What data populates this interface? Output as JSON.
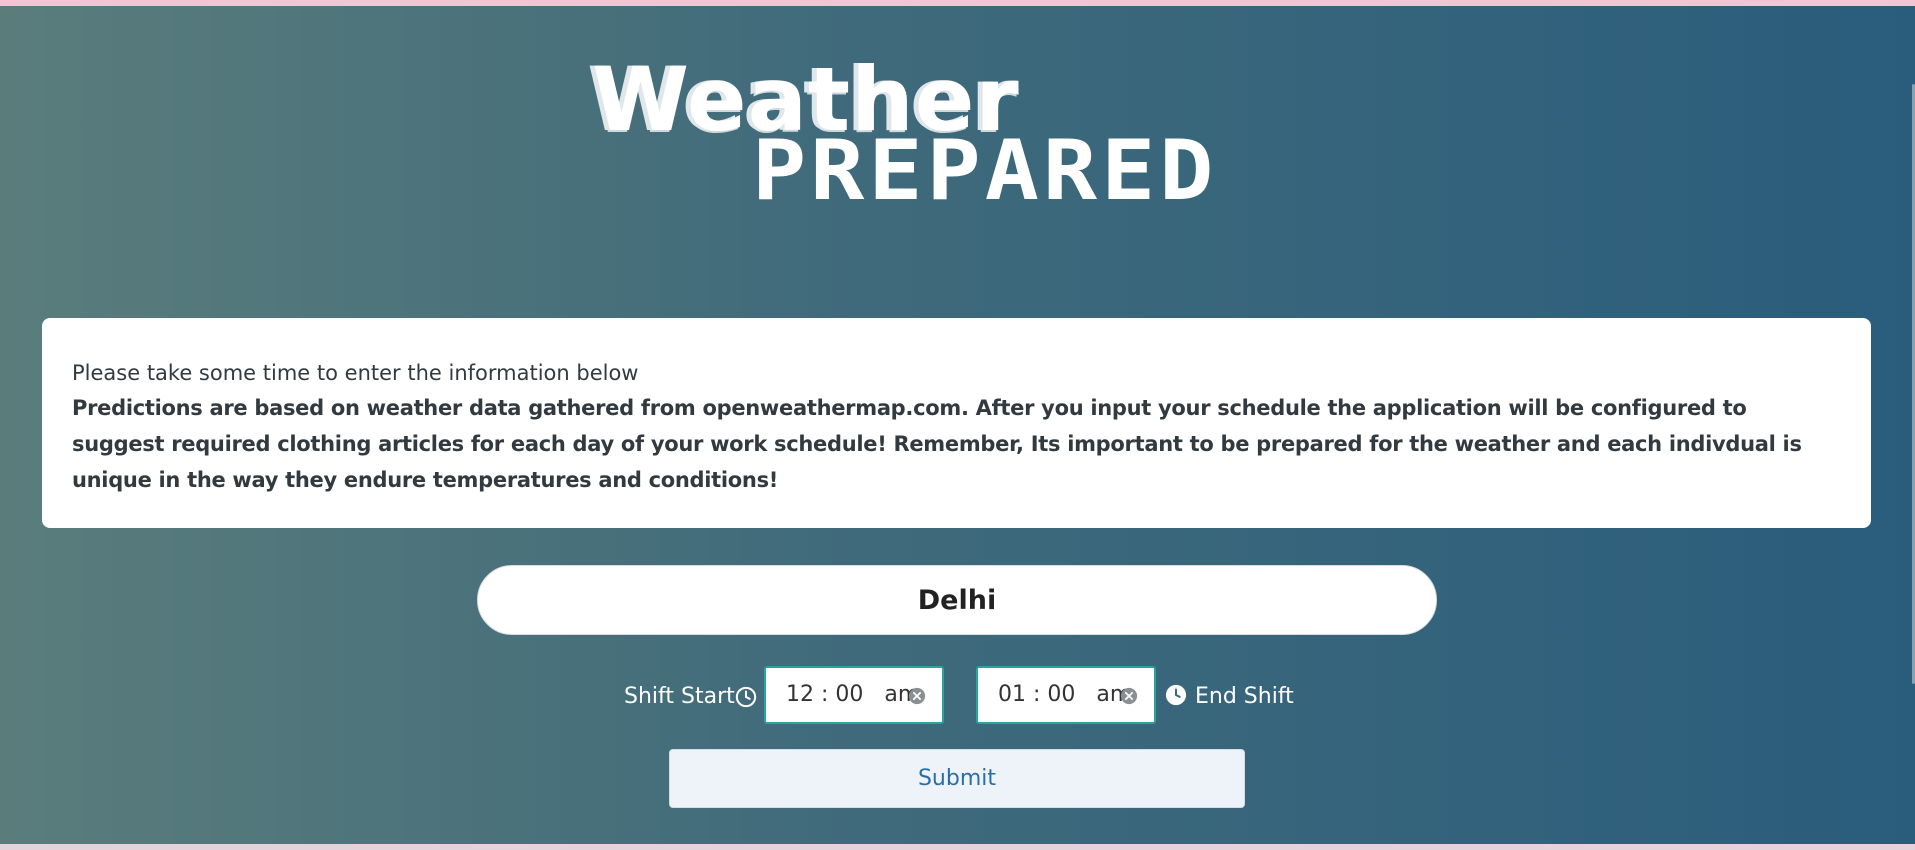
{
  "logo": {
    "line1": "Weather",
    "line2": "PREPARED"
  },
  "info": {
    "lead": "Please take some time to enter the information below",
    "body": "Predictions are based on weather data gathered from openweathermap.com. After you input your schedule the application will be configured to suggest required clothing articles for each day of your work schedule! Remember, Its important to be prepared for the weather and each indivdual is unique in the way they endure temperatures and conditions!"
  },
  "city": {
    "value": "Delhi"
  },
  "shift": {
    "start_label": "Shift Start",
    "start_time": "12 : 00   am",
    "end_time": "01 : 00   am",
    "end_label": "End Shift"
  },
  "submit": {
    "label": "Submit"
  },
  "colors": {
    "accent": "#27a5a0",
    "submit_text": "#2a6ea8",
    "background_left": "#5a7d7c",
    "background_right": "#2a5d7c"
  }
}
